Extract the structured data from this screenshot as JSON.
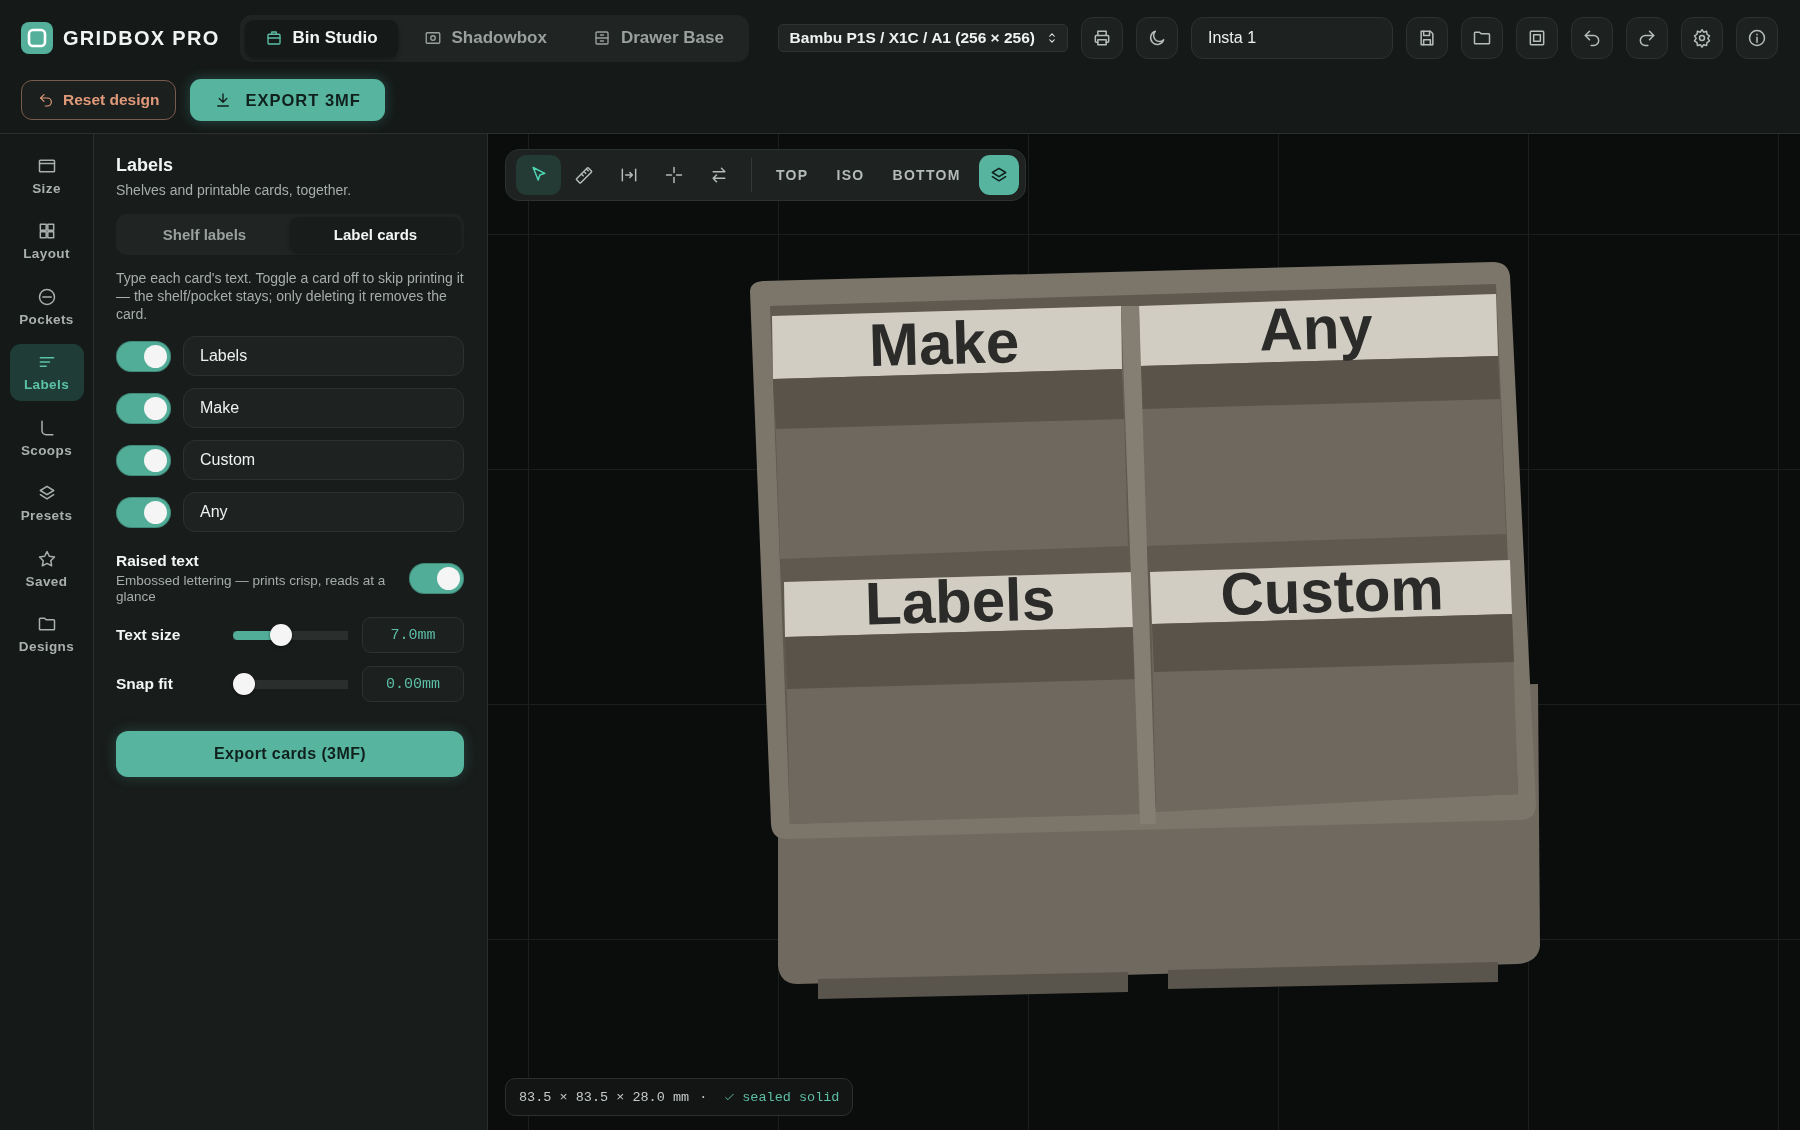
{
  "app": {
    "name": "GRIDBOX PRO"
  },
  "mode_tabs": [
    {
      "label": "Bin Studio",
      "kind": "bin",
      "selected": true
    },
    {
      "label": "Shadowbox",
      "kind": "shadow",
      "selected": false
    },
    {
      "label": "Drawer Base",
      "kind": "drawer",
      "selected": false
    }
  ],
  "printer_select": {
    "value": "Bambu P1S / X1C / A1 (256 × 256)"
  },
  "project_name": {
    "value": "Insta 1"
  },
  "actions": {
    "reset": "Reset design",
    "export": "EXPORT 3MF"
  },
  "rail": [
    {
      "label": "Size",
      "kind": "size",
      "selected": false
    },
    {
      "label": "Layout",
      "kind": "layout",
      "selected": false
    },
    {
      "label": "Pockets",
      "kind": "pockets",
      "selected": false
    },
    {
      "label": "Labels",
      "kind": "labels",
      "selected": true
    },
    {
      "label": "Scoops",
      "kind": "scoops",
      "selected": false
    },
    {
      "label": "Presets",
      "kind": "presets",
      "selected": false
    },
    {
      "label": "Saved",
      "kind": "saved",
      "selected": false
    },
    {
      "label": "Designs",
      "kind": "designs",
      "selected": false
    }
  ],
  "panel": {
    "title": "Labels",
    "subtitle": "Shelves and printable cards, together.",
    "segments": [
      {
        "label": "Shelf labels",
        "selected": false
      },
      {
        "label": "Label cards",
        "selected": true
      }
    ],
    "description": "Type each card's text. Toggle a card off to skip printing it — the shelf/pocket stays; only deleting it removes the card.",
    "cards": [
      {
        "text": "Labels",
        "on": true
      },
      {
        "text": "Make",
        "on": true
      },
      {
        "text": "Custom",
        "on": true
      },
      {
        "text": "Any",
        "on": true
      }
    ],
    "raised_text": {
      "title": "Raised text",
      "description": "Embossed lettering — prints crisp, reads at a glance",
      "on": true
    },
    "sliders": [
      {
        "label": "Text size",
        "level": 0.4,
        "reading": "7.0mm"
      },
      {
        "label": "Snap fit",
        "level": 0,
        "reading": "0.00mm"
      }
    ],
    "export_button": "Export cards (3MF)"
  },
  "viewport": {
    "tools": [
      {
        "kind": "pointer",
        "selected": true
      },
      {
        "kind": "ruler",
        "selected": false
      },
      {
        "kind": "fit",
        "selected": false
      },
      {
        "kind": "crosshair",
        "selected": false
      },
      {
        "kind": "swap",
        "selected": false
      }
    ],
    "views": [
      "TOP",
      "ISO",
      "BOTTOM"
    ],
    "layers": {
      "on": true
    },
    "model_labels": [
      "Make",
      "Any",
      "Labels",
      "Custom"
    ],
    "status": {
      "dimensions": "83.5 × 83.5 × 28.0 mm",
      "separator": "·",
      "check": "sealed solid"
    }
  }
}
